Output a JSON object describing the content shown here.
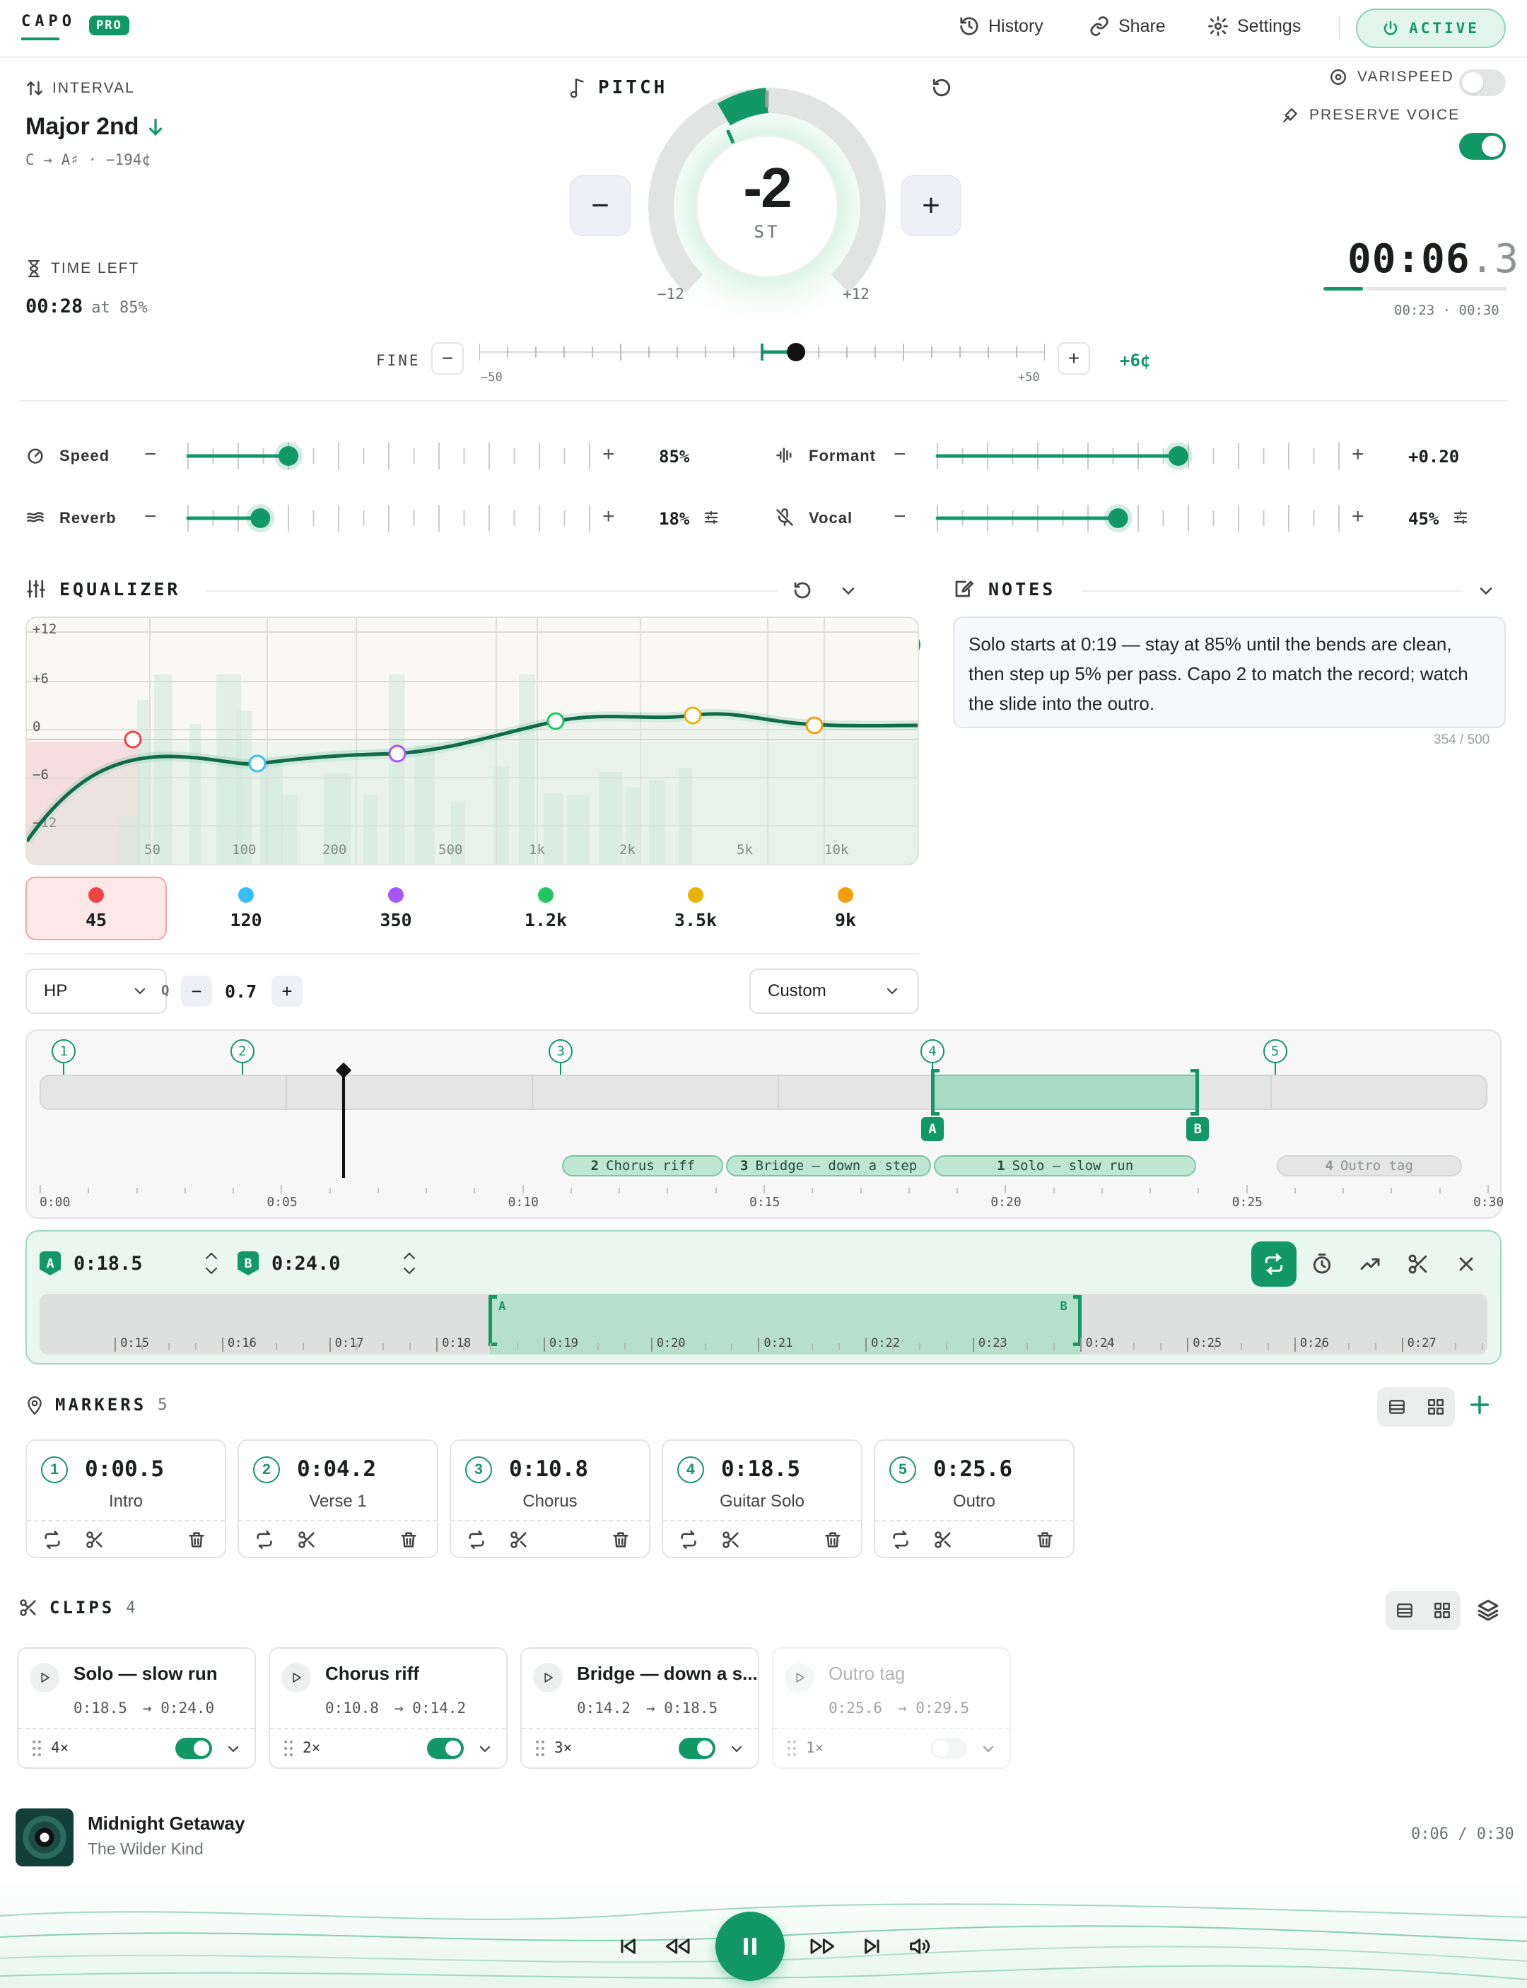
{
  "app": {
    "logo": "CAPO",
    "badge": "PRO"
  },
  "header": {
    "history": "History",
    "share": "Share",
    "settings": "Settings",
    "active": "ACTIVE"
  },
  "interval": {
    "label": "INTERVAL",
    "name": "Major 2nd",
    "detail": "C → A♯ · −194¢"
  },
  "time_left": {
    "label": "TIME LEFT",
    "value": "00:28",
    "suffix": "at 85%"
  },
  "pitch": {
    "label": "PITCH",
    "value": "-2",
    "unit": "ST",
    "min": "−12",
    "max": "+12",
    "minus": "−",
    "plus": "+"
  },
  "toggles": {
    "varispeed": "VARISPEED",
    "varispeed_on": false,
    "preserve": "PRESERVE VOICE",
    "preserve_on": true
  },
  "clock": {
    "main": "00:06",
    "frac": ".3",
    "range": "00:23 · 00:30",
    "progress": 0.2
  },
  "fine": {
    "label": "FINE",
    "min": "−50",
    "max": "+50",
    "value": "+6¢",
    "minus": "−",
    "plus": "+"
  },
  "sliders": [
    {
      "label": "Speed",
      "value": "85%",
      "level": 0.25
    },
    {
      "label": "Formant",
      "value": "+0.20",
      "level": 0.6
    },
    {
      "label": "Reverb",
      "value": "18%",
      "level": 0.18
    },
    {
      "label": "Vocal",
      "value": "45%",
      "level": 0.45
    }
  ],
  "equalizer": {
    "label": "EQUALIZER",
    "y_ticks": [
      "+12",
      "+6",
      "0",
      "−6",
      "−12"
    ],
    "x_ticks": [
      "50",
      "100",
      "200",
      "500",
      "1k",
      "2k",
      "5k",
      "10k"
    ],
    "bands": [
      {
        "freq": "45",
        "color": "#ef4444"
      },
      {
        "freq": "120",
        "color": "#38bdf8"
      },
      {
        "freq": "350",
        "color": "#a855f7"
      },
      {
        "freq": "1.2k",
        "color": "#22c55e"
      },
      {
        "freq": "3.5k",
        "color": "#eab308"
      },
      {
        "freq": "9k",
        "color": "#f59e0b"
      }
    ],
    "filter_type": "HP",
    "q_label": "Q",
    "q_value": "0.7",
    "preset": "Custom",
    "minus": "−",
    "plus": "+"
  },
  "notes": {
    "label": "NOTES",
    "text": "Solo starts at 0:19 — stay at 85% until the bends are clean, then step up 5% per pass. Capo 2 to match the record; watch the slide into the outro.",
    "count": "354 / 500"
  },
  "timeline": {
    "pins": [
      "1",
      "2",
      "3",
      "4",
      "5"
    ],
    "a": "A",
    "b": "B",
    "ticks": [
      "0:00",
      "0:05",
      "0:10",
      "0:15",
      "0:20",
      "0:25",
      "0:30"
    ],
    "tags": [
      {
        "n": "2",
        "t": "Chorus riff"
      },
      {
        "n": "3",
        "t": "Bridge — down a step"
      },
      {
        "n": "1",
        "t": "Solo — slow run"
      },
      {
        "n": "4",
        "t": "Outro tag"
      }
    ]
  },
  "loop": {
    "a": "A",
    "a_time": "0:18.5",
    "b": "B",
    "b_time": "0:24.0",
    "ticks": [
      "0:15",
      "0:16",
      "0:17",
      "0:18",
      "0:19",
      "0:20",
      "0:21",
      "0:22",
      "0:23",
      "0:24",
      "0:25",
      "0:26",
      "0:27"
    ]
  },
  "markers": {
    "label": "MARKERS",
    "count": "5",
    "items": [
      {
        "n": "1",
        "time": "0:00.5",
        "name": "Intro"
      },
      {
        "n": "2",
        "time": "0:04.2",
        "name": "Verse 1"
      },
      {
        "n": "3",
        "time": "0:10.8",
        "name": "Chorus"
      },
      {
        "n": "4",
        "time": "0:18.5",
        "name": "Guitar Solo"
      },
      {
        "n": "5",
        "time": "0:25.6",
        "name": "Outro"
      }
    ]
  },
  "clips": {
    "label": "CLIPS",
    "count": "4",
    "items": [
      {
        "title": "Solo — slow run",
        "start": "0:18.5",
        "end": "→ 0:24.0",
        "rep": "4×",
        "on": true
      },
      {
        "title": "Chorus riff",
        "start": "0:10.8",
        "end": "→ 0:14.2",
        "rep": "2×",
        "on": true
      },
      {
        "title": "Bridge — down a s...",
        "start": "0:14.2",
        "end": "→ 0:18.5",
        "rep": "3×",
        "on": true
      },
      {
        "title": "Outro tag",
        "start": "0:25.6",
        "end": "→ 0:29.5",
        "rep": "1×",
        "on": false
      }
    ]
  },
  "player": {
    "title": "Midnight Getaway",
    "artist": "The Wilder Kind",
    "time": "0:06 / 0:30",
    "progress": 0.2
  }
}
